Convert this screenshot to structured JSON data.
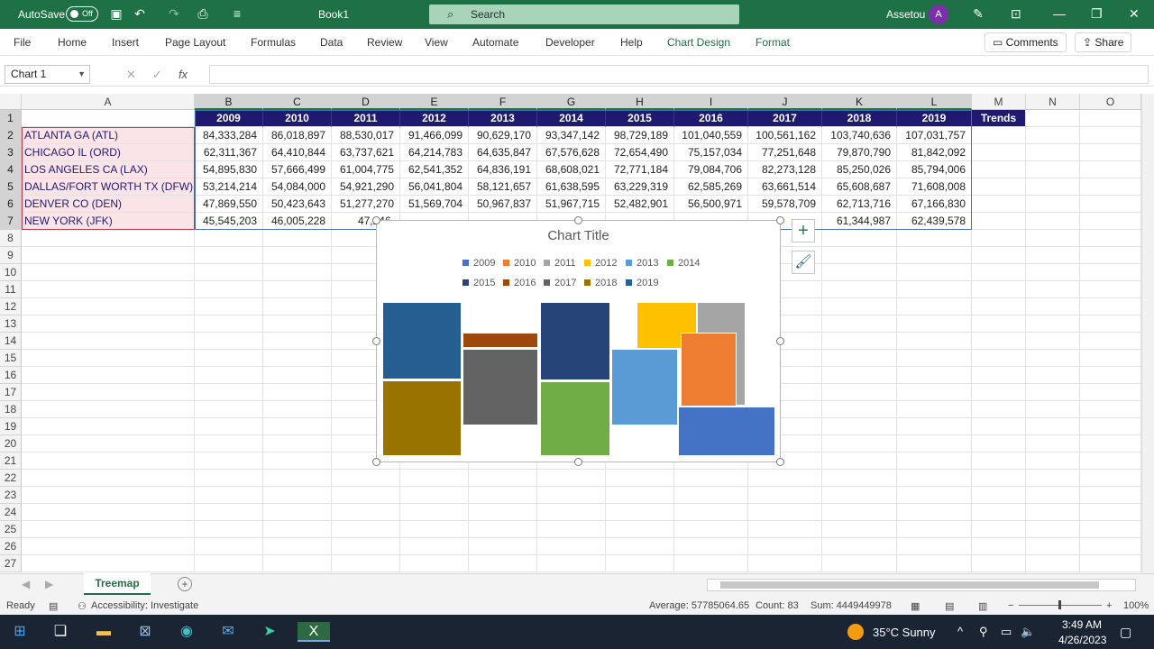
{
  "titlebar": {
    "autosave_label": "AutoSave",
    "autosave_state": "Off",
    "doc_title": "Book1",
    "search_placeholder": "Search",
    "user_name": "Assetou",
    "user_initial": "A"
  },
  "ribbon": {
    "tabs": [
      "File",
      "Home",
      "Insert",
      "Page Layout",
      "Formulas",
      "Data",
      "Review",
      "View",
      "Automate",
      "Developer",
      "Help",
      "Chart Design",
      "Format"
    ],
    "comments_label": "Comments",
    "share_label": "Share"
  },
  "formula_bar": {
    "name_box": "Chart 1",
    "fx_label": "fx",
    "value": ""
  },
  "grid": {
    "columns": [
      "A",
      "B",
      "C",
      "D",
      "E",
      "F",
      "G",
      "H",
      "I",
      "J",
      "K",
      "L",
      "M",
      "N",
      "O"
    ],
    "rows": [
      "1",
      "2",
      "3",
      "4",
      "5",
      "6",
      "7",
      "8",
      "9",
      "10",
      "11",
      "12",
      "13",
      "14",
      "15",
      "16",
      "17",
      "18",
      "19",
      "20",
      "21",
      "22",
      "23",
      "24",
      "25",
      "26",
      "27"
    ],
    "years": [
      "2009",
      "2010",
      "2011",
      "2012",
      "2013",
      "2014",
      "2015",
      "2016",
      "2017",
      "2018",
      "2019"
    ],
    "trends_label": "Trends",
    "data_rows": [
      {
        "city": "ATLANTA GA (ATL)",
        "values": [
          "84,333,284",
          "86,018,897",
          "88,530,017",
          "91,466,099",
          "90,629,170",
          "93,347,142",
          "98,729,189",
          "101,040,559",
          "100,561,162",
          "103,740,636",
          "107,031,757"
        ]
      },
      {
        "city": "CHICAGO IL (ORD)",
        "values": [
          "62,311,367",
          "64,410,844",
          "63,737,621",
          "64,214,783",
          "64,635,847",
          "67,576,628",
          "72,654,490",
          "75,157,034",
          "77,251,648",
          "79,870,790",
          "81,842,092"
        ]
      },
      {
        "city": "LOS ANGELES CA (LAX)",
        "values": [
          "54,895,830",
          "57,666,499",
          "61,004,775",
          "62,541,352",
          "64,836,191",
          "68,608,021",
          "72,771,184",
          "79,084,706",
          "82,273,128",
          "85,250,026",
          "85,794,006"
        ]
      },
      {
        "city": "DALLAS/FORT WORTH TX (DFW)",
        "values": [
          "53,214,214",
          "54,084,000",
          "54,921,290",
          "56,041,804",
          "58,121,657",
          "61,638,595",
          "63,229,319",
          "62,585,269",
          "63,661,514",
          "65,608,687",
          "71,608,008"
        ]
      },
      {
        "city": "DENVER CO (DEN)",
        "values": [
          "47,869,550",
          "50,423,643",
          "51,277,270",
          "51,569,704",
          "50,967,837",
          "51,967,715",
          "52,482,901",
          "56,500,971",
          "59,578,709",
          "62,713,716",
          "67,166,830"
        ]
      },
      {
        "city": "NEW YORK (JFK)",
        "values": [
          "45,545,203",
          "46,005,228",
          "47,246,",
          "",
          "",
          "",
          "",
          "",
          "",
          "61,344,987",
          "62,439,578"
        ]
      }
    ]
  },
  "chart": {
    "title": "Chart Title",
    "legend": [
      {
        "label": "2009",
        "color": "#4472c4"
      },
      {
        "label": "2010",
        "color": "#ed7d31"
      },
      {
        "label": "2011",
        "color": "#a5a5a5"
      },
      {
        "label": "2012",
        "color": "#ffc000"
      },
      {
        "label": "2013",
        "color": "#5b9bd5"
      },
      {
        "label": "2014",
        "color": "#70ad47"
      },
      {
        "label": "2015",
        "color": "#264478"
      },
      {
        "label": "2016",
        "color": "#9e480e"
      },
      {
        "label": "2017",
        "color": "#636363"
      },
      {
        "label": "2018",
        "color": "#997300"
      },
      {
        "label": "2019",
        "color": "#255e91"
      }
    ]
  },
  "sheet_tab": "Treemap",
  "status": {
    "ready": "Ready",
    "accessibility": "Accessibility: Investigate",
    "average": "Average: 57785064.65",
    "count": "Count: 83",
    "sum": "Sum: 4449449978",
    "zoom": "100%"
  },
  "taskbar": {
    "weather": "35°C  Sunny",
    "time": "3:49 AM",
    "date": "4/26/2023"
  }
}
